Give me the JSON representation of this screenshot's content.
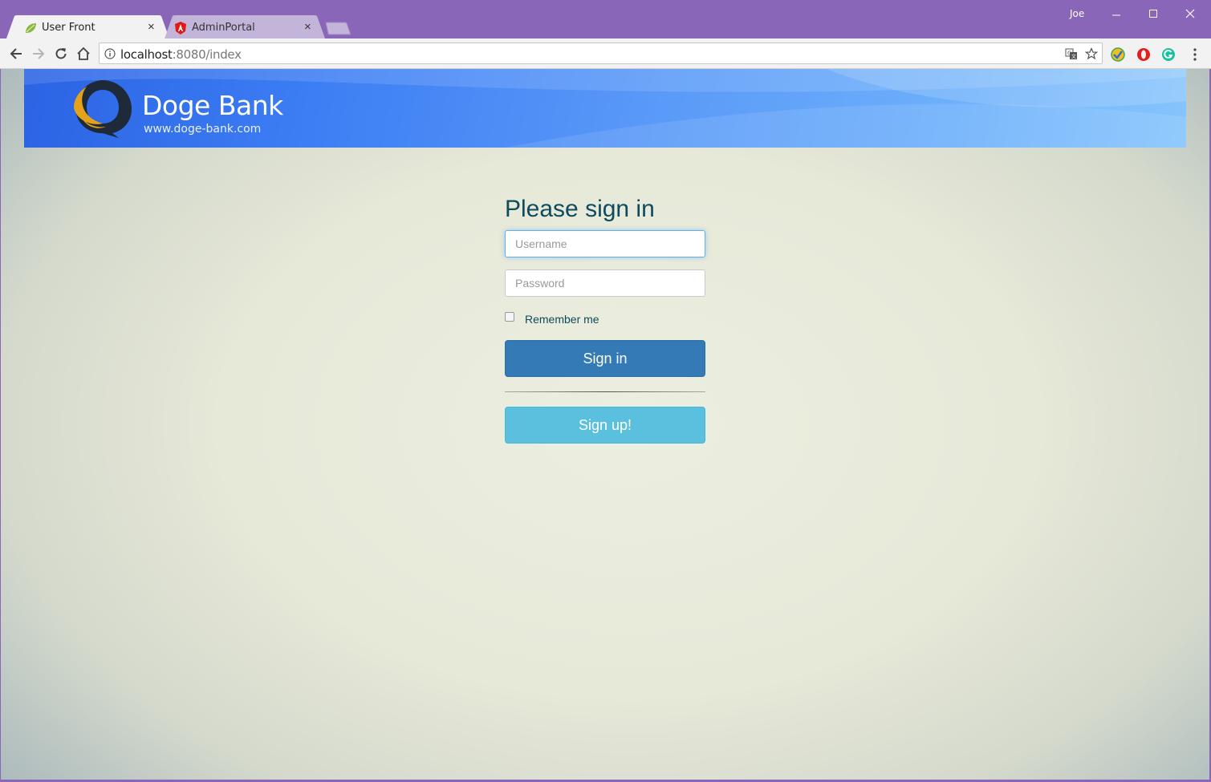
{
  "browser": {
    "profile_name": "Joe",
    "tabs": [
      {
        "title": "User Front",
        "favicon": "spring-leaf-icon",
        "close": "×"
      },
      {
        "title": "AdminPortal",
        "favicon": "angular-icon",
        "close": "×"
      }
    ],
    "url": {
      "host": "localhost",
      "path": ":8080/index"
    }
  },
  "banner": {
    "brand_name": "Doge Bank",
    "brand_url": "www.doge-bank.com"
  },
  "login": {
    "heading": "Please sign in",
    "username_placeholder": "Username",
    "password_placeholder": "Password",
    "remember_label": "Remember me",
    "signin_label": "Sign in",
    "signup_label": "Sign up!"
  },
  "colors": {
    "titlebar": "#8a66b9",
    "primary_button": "#337ab7",
    "info_button": "#5bc0de",
    "heading_text": "#0f4b5c"
  }
}
